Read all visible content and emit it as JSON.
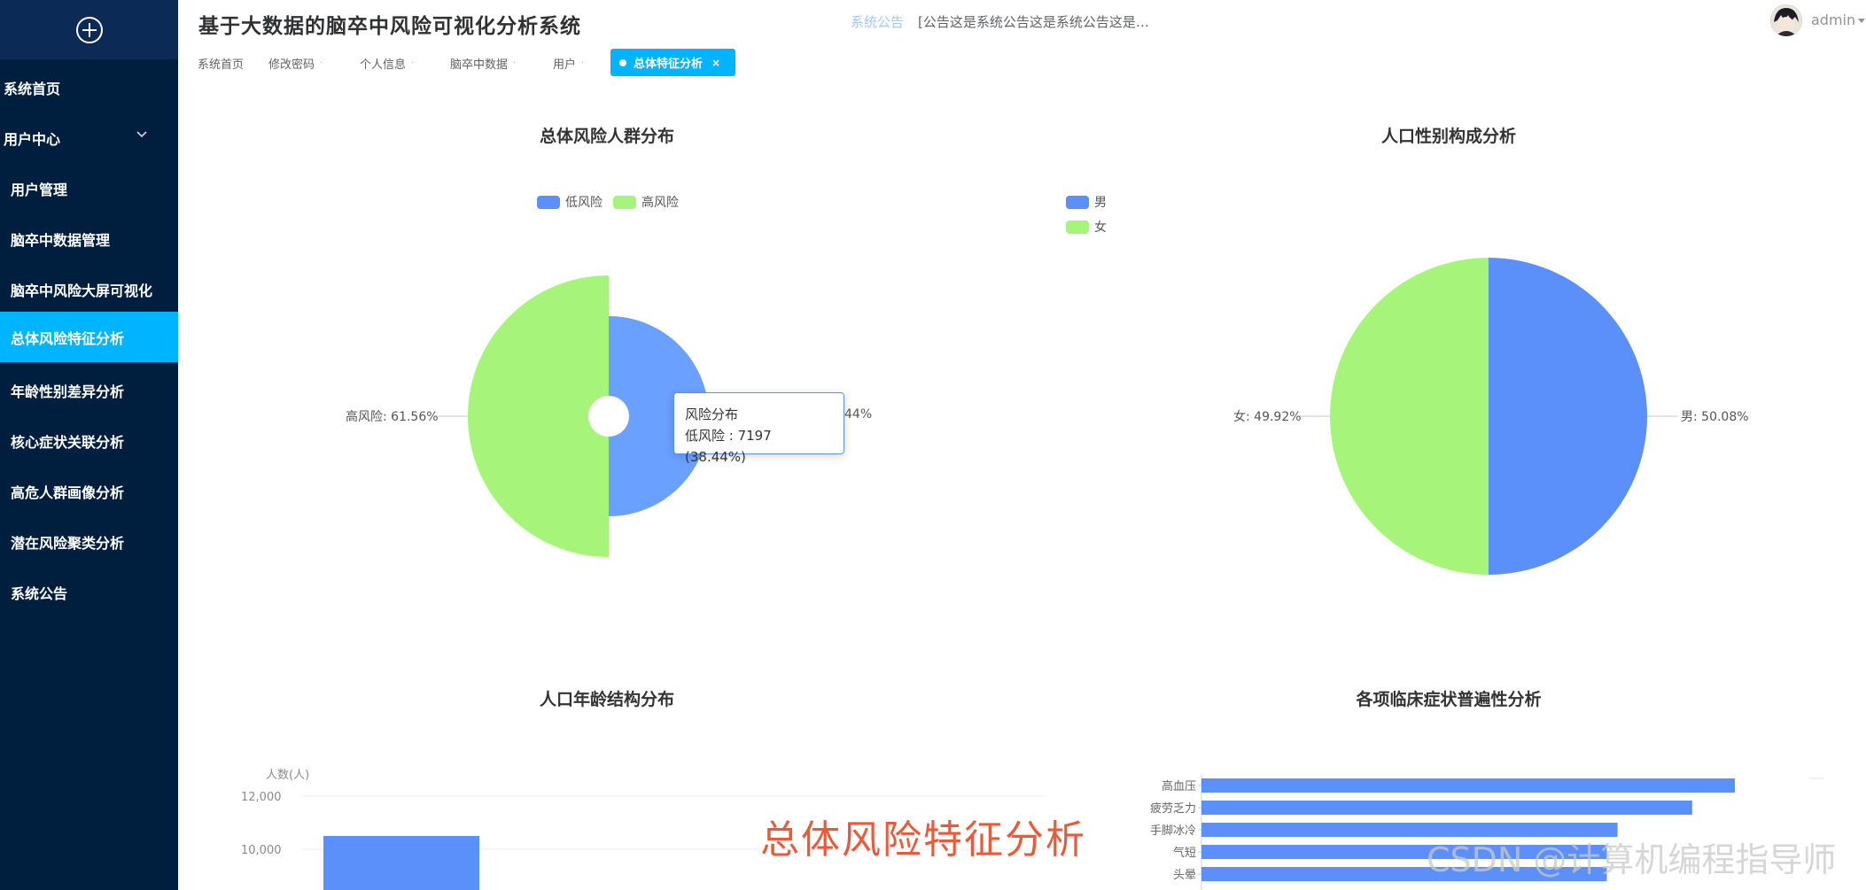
{
  "app": {
    "title": "基于大数据的脑卒中风险可视化分析系统",
    "notice_label": "系统公告",
    "notice_text": "[公告这是系统公告这是系统公告这是…",
    "user_name": "admin"
  },
  "sidebar": {
    "items": [
      {
        "label": "系统首页"
      },
      {
        "label": "用户中心"
      },
      {
        "label": "用户管理"
      },
      {
        "label": "脑卒中数据管理"
      },
      {
        "label": "脑卒中风险大屏可视化"
      },
      {
        "label": "总体风险特征分析"
      },
      {
        "label": "年龄性别差异分析"
      },
      {
        "label": "核心症状关联分析"
      },
      {
        "label": "高危人群画像分析"
      },
      {
        "label": "潜在风险聚类分析"
      },
      {
        "label": "系统公告"
      }
    ],
    "active_index": 5
  },
  "tabs": {
    "items": [
      {
        "label": "系统首页"
      },
      {
        "label": "修改密码"
      },
      {
        "label": "个人信息"
      },
      {
        "label": "脑卒中数据"
      },
      {
        "label": "用户"
      }
    ],
    "active_label": "总体特征分析"
  },
  "colors": {
    "sidebar_bg": "#001f3f",
    "accent": "#00b4ff",
    "blue_series": "#5b8ff9",
    "green_series": "#a6f57a"
  },
  "watermark": "总体风险特征分析",
  "csdn_mark": "CSDN @计算机编程指导师",
  "chart_data": [
    {
      "type": "pie",
      "title": "总体风险人群分布",
      "legend": [
        "低风险",
        "高风险"
      ],
      "slices": [
        {
          "name": "低风险",
          "value": 7197,
          "percent_label": "38.44%"
        },
        {
          "name": "高风险",
          "percent_label": "高风险: 61.56%"
        }
      ],
      "visible_label_fragment": "44%",
      "tooltip": {
        "title": "风险分布",
        "text": "低风险 : 7197 (38.44%)"
      }
    },
    {
      "type": "pie",
      "title": "人口性别构成分析",
      "legend": [
        "男",
        "女"
      ],
      "slices": [
        {
          "name": "男",
          "percent": 50.08,
          "label": "男: 50.08%"
        },
        {
          "name": "女",
          "percent": 49.92,
          "label": "女: 49.92%"
        }
      ]
    },
    {
      "type": "bar",
      "title": "人口年龄结构分布",
      "ylabel": "人数(人)",
      "y_ticks": [
        "12,000",
        "10,000"
      ],
      "visible_bar_values": [
        10500
      ]
    },
    {
      "type": "bar",
      "orientation": "horizontal",
      "title": "各项临床症状普遍性分析",
      "categories": [
        "高血压",
        "疲劳乏力",
        "手脚冰冷",
        "气短",
        "头晕"
      ],
      "values": [
        100,
        92,
        78,
        76,
        76
      ]
    }
  ]
}
